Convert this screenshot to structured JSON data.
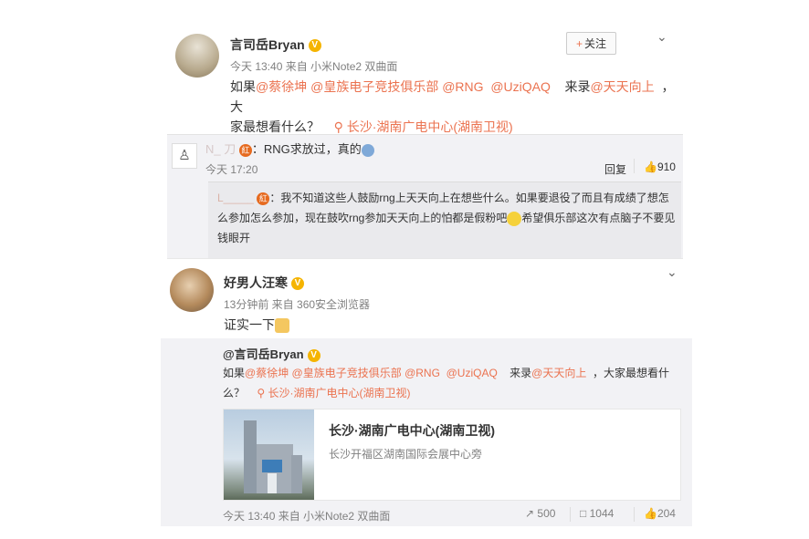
{
  "post1": {
    "author": "言司岳Bryan",
    "verified_badge": "V",
    "meta": "今天 13:40 来自 小米Note2 双曲面",
    "follow_plus": "+",
    "follow_label": "关注",
    "text_prefix": "如果",
    "mentions": [
      "@蔡徐坤",
      "@皇族电子竞技俱乐部",
      "@RNG",
      "@UziQAQ"
    ],
    "record_label": "来录",
    "record_mention": "@天天向上",
    "text_suffix_1": "，大",
    "text_suffix_2": "家最想看什么？",
    "location": "长沙·湖南广电中心(湖南卫视)"
  },
  "comment1": {
    "name": "N_ 刀",
    "text": "：RNG求放过，真的",
    "time": "今天 17:20",
    "reply_label": "回复",
    "like_count": "910"
  },
  "reply1": {
    "name": "L_____",
    "text": "：我不知道这些人鼓励rng上天天向上在想些什么。如果要退役了而且有成绩了想怎么参加怎么参加，现在鼓吹rng参加天天向上的怕都是假粉吧",
    "text_end": "希望俱乐部这次有点脑子不要见钱眼开"
  },
  "post2": {
    "author": "好男人汪寒",
    "verified_badge": "V",
    "meta": "13分钟前 来自 360安全浏览器",
    "text": "证实一下",
    "quote": {
      "author": "@言司岳Bryan",
      "text_prefix": "如果",
      "mentions": [
        "@蔡徐坤",
        "@皇族电子竞技俱乐部",
        "@RNG",
        "@UziQAQ"
      ],
      "record_label": "来录",
      "record_mention": "@天天向上",
      "text_suffix": "，大家最想看什",
      "text_line2": "么？",
      "location": "长沙·湖南广电中心(湖南卫视)",
      "card_title": "长沙·湖南广电中心(湖南卫视)",
      "card_subtitle": "长沙开福区湖南国际会展中心旁",
      "meta": "今天 13:40 来自 小米Note2 双曲面",
      "repost_count": "500",
      "comment_count": "1044",
      "like_count": "204"
    }
  },
  "colors": {
    "link": "#eb7350",
    "badge": "#f5b400",
    "panel": "#f2f2f5"
  }
}
